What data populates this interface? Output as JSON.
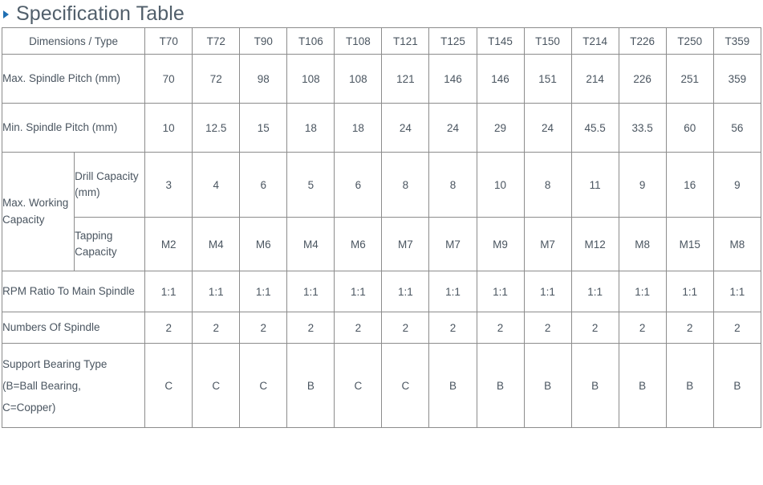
{
  "page": {
    "title": "Specification Table",
    "bullet_icon": "triangle-right-icon",
    "accent_color": "#1f6fb2",
    "text_color": "#4a5560",
    "border_color": "#8c8c8c"
  },
  "table": {
    "header": {
      "label": "Dimensions / Type",
      "types": [
        "T70",
        "T72",
        "T90",
        "T106",
        "T108",
        "T121",
        "T125",
        "T145",
        "T150",
        "T214",
        "T226",
        "T250",
        "T359"
      ]
    },
    "rows": [
      {
        "label": "Max. Spindle Pitch (mm)",
        "values": [
          "70",
          "72",
          "98",
          "108",
          "108",
          "121",
          "146",
          "146",
          "151",
          "214",
          "226",
          "251",
          "359"
        ]
      },
      {
        "label": "Min. Spindle Pitch (mm)",
        "values": [
          "10",
          "12.5",
          "15",
          "18",
          "18",
          "24",
          "24",
          "29",
          "24",
          "45.5",
          "33.5",
          "60",
          "56"
        ]
      },
      {
        "label": "Max. Working Capacity",
        "sublabel": "Drill Capacity (mm)",
        "values": [
          "3",
          "4",
          "6",
          "5",
          "6",
          "8",
          "8",
          "10",
          "8",
          "11",
          "9",
          "16",
          "9"
        ]
      },
      {
        "sublabel": "Tapping Capacity",
        "values": [
          "M2",
          "M4",
          "M6",
          "M4",
          "M6",
          "M7",
          "M7",
          "M9",
          "M7",
          "M12",
          "M8",
          "M15",
          "M8"
        ]
      },
      {
        "label": "RPM Ratio To Main Spindle",
        "values": [
          "1:1",
          "1:1",
          "1:1",
          "1:1",
          "1:1",
          "1:1",
          "1:1",
          "1:1",
          "1:1",
          "1:1",
          "1:1",
          "1:1",
          "1:1"
        ]
      },
      {
        "label": "Numbers Of Spindle",
        "values": [
          "2",
          "2",
          "2",
          "2",
          "2",
          "2",
          "2",
          "2",
          "2",
          "2",
          "2",
          "2",
          "2"
        ]
      },
      {
        "label": "Support Bearing Type (B=Ball Bearing, C=Copper)",
        "label_lines": [
          "Support Bearing Type",
          "(B=Ball Bearing,",
          "C=Copper)"
        ],
        "values": [
          "C",
          "C",
          "C",
          "B",
          "C",
          "C",
          "B",
          "B",
          "B",
          "B",
          "B",
          "B",
          "B"
        ]
      }
    ]
  }
}
